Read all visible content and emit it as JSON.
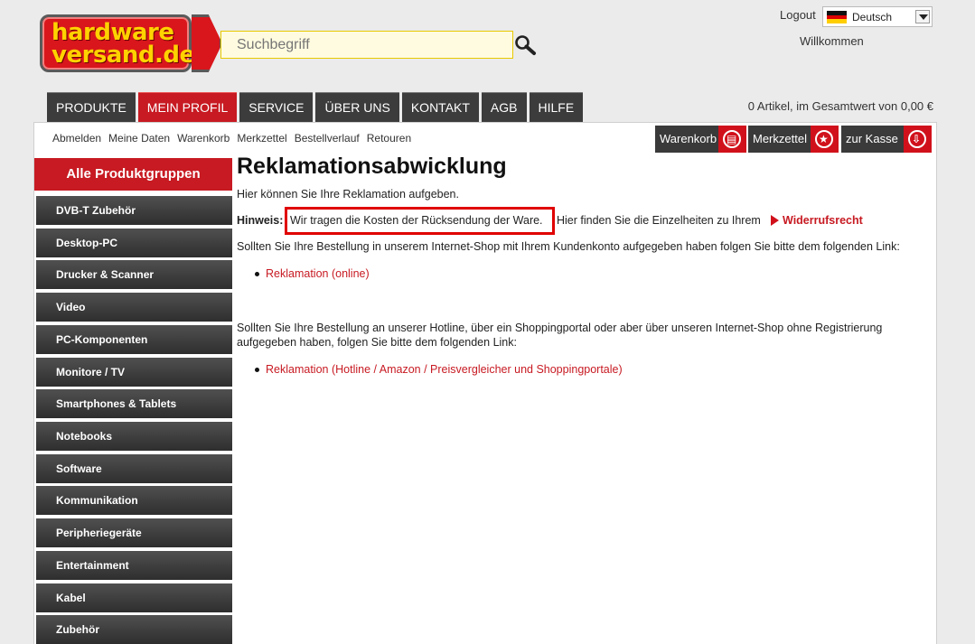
{
  "logo": {
    "line1": "hardware",
    "line2": "versand.de"
  },
  "search": {
    "placeholder": "Suchbegriff",
    "icon": "search-icon"
  },
  "user_bar": {
    "logout": "Logout",
    "language": "Deutsch",
    "welcome": "Willkommen"
  },
  "main_nav": [
    "PRODUKTE",
    "MEIN PROFIL",
    "SERVICE",
    "ÜBER UNS",
    "KONTAKT",
    "AGB",
    "HILFE"
  ],
  "main_nav_active": "MEIN PROFIL",
  "cart_summary": "0 Artikel, im Gesamtwert von 0,00 €",
  "sub_nav": [
    "Abmelden",
    "Meine Daten",
    "Warenkorb",
    "Merkzettel",
    "Bestellverlauf",
    "Retouren"
  ],
  "toolbar": {
    "cart": "Warenkorb",
    "wishlist": "Merkzettel",
    "checkout": "zur Kasse"
  },
  "sidebar": {
    "header": "Alle Produktgruppen",
    "categories": [
      "DVB-T Zubehör",
      "Desktop-PC",
      "Drucker & Scanner",
      "Video",
      "PC-Komponenten",
      "Monitore / TV",
      "Smartphones & Tablets",
      "Notebooks",
      "Software",
      "Kommunikation",
      "Peripheriegeräte",
      "Entertainment",
      "Kabel",
      "Zubehör"
    ]
  },
  "content": {
    "title": "Reklamationsabwicklung",
    "intro": "Hier können Sie Ihre Reklamation aufgeben.",
    "hint_label": "Hinweis:",
    "hint_text": "Wir tragen die Kosten der Rücksendung der Ware.",
    "hint_rest": "Hier finden Sie die Einzelheiten zu Ihrem",
    "widerruf_link": "Widerrufsrecht",
    "para1": "Sollten Sie Ihre Bestellung in unserem Internet-Shop mit Ihrem Kundenkonto aufgegeben haben folgen Sie bitte dem folgenden Link:",
    "link1": "Reklamation (online)",
    "para2_line1": "Sollten Sie Ihre Bestellung an unserer Hotline, über ein Shoppingportal oder aber über unseren Internet-Shop ohne Registrierung",
    "para2_line2": "aufgegeben haben, folgen Sie bitte dem folgenden Link:",
    "link2": "Reklamation (Hotline / Amazon / Preisvergleicher und Shoppingportale)"
  },
  "colors": {
    "brand_red": "#c71a22",
    "logo_yellow": "#ffd200",
    "nav_dark": "#3c3c3c",
    "hint_border": "#e00000"
  }
}
